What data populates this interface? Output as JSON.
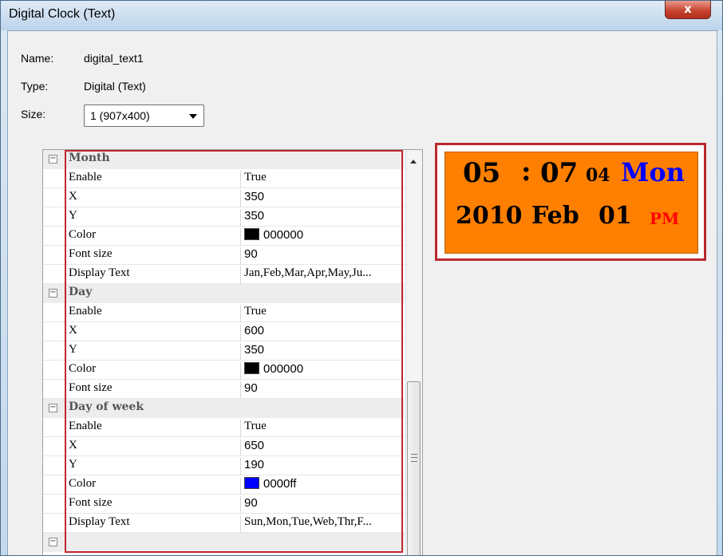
{
  "window": {
    "title": "Digital Clock (Text)",
    "close_label": "x"
  },
  "info": {
    "name_label": "Name:",
    "name_value": "digital_text1",
    "type_label": "Type:",
    "type_value": "Digital (Text)",
    "size_label": "Size:",
    "size_value": "1  (907x400)"
  },
  "properties": {
    "month": {
      "title": "Month",
      "enable_label": "Enable",
      "enable": "True",
      "x_label": "X",
      "x": "350",
      "y_label": "Y",
      "y": "350",
      "color_label": "Color",
      "color": "000000",
      "color_hex": "#000000",
      "font_size_label": "Font size",
      "font_size": "90",
      "display_text_label": "Display Text",
      "display_text": "Jan,Feb,Mar,Apr,May,Ju..."
    },
    "day": {
      "title": "Day",
      "enable_label": "Enable",
      "enable": "True",
      "x_label": "X",
      "x": "600",
      "y_label": "Y",
      "y": "350",
      "color_label": "Color",
      "color": "000000",
      "color_hex": "#000000",
      "font_size_label": "Font size",
      "font_size": "90"
    },
    "day_of_week": {
      "title": "Day of week",
      "enable_label": "Enable",
      "enable": "True",
      "x_label": "X",
      "x": "650",
      "y_label": "Y",
      "y": "190",
      "color_label": "Color",
      "color": "0000ff",
      "color_hex": "#0000ff",
      "font_size_label": "Font size",
      "font_size": "90",
      "display_text_label": "Display Text",
      "display_text": "Sun,Mon,Tue,Web,Thr,F..."
    },
    "toggle_symbol": "−"
  },
  "preview": {
    "time": "05",
    "colon": ":",
    "minute": "07",
    "seconds": "04",
    "weekday": "Mon",
    "year": "2010",
    "month": "Feb",
    "day": "01",
    "ampm": "PM",
    "background": "#ff7f00",
    "weekday_color": "#0000ff",
    "ampm_color": "#ff0000"
  }
}
